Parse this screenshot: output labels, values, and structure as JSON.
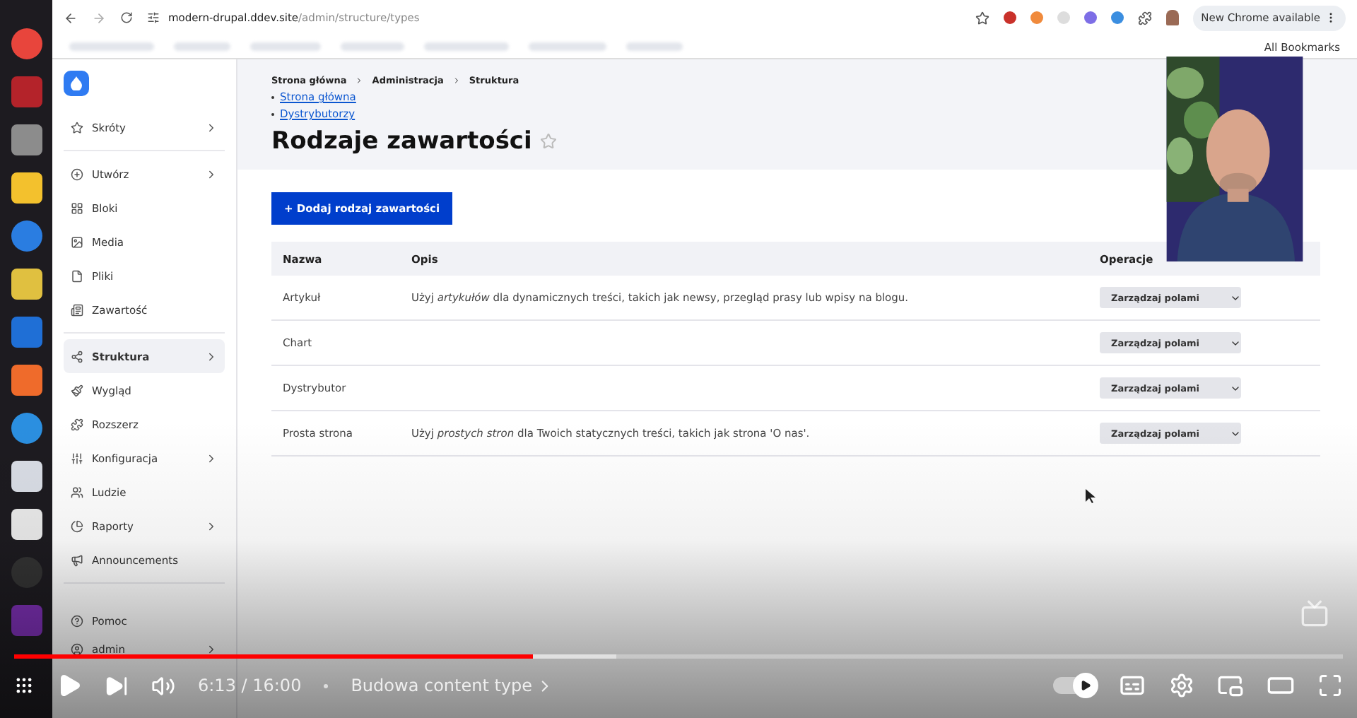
{
  "browser": {
    "url_host": "modern-drupal.ddev.site",
    "url_path": "/admin/structure/types",
    "update_button": "New Chrome available",
    "bookmarks_label": "All Bookmarks"
  },
  "sidebar": {
    "sections": [
      {
        "items": [
          {
            "label": "Skróty",
            "has_children": true,
            "selected": false
          }
        ]
      },
      {
        "items": [
          {
            "label": "Utwórz",
            "has_children": true,
            "selected": false
          },
          {
            "label": "Bloki",
            "has_children": false,
            "selected": false
          },
          {
            "label": "Media",
            "has_children": false,
            "selected": false
          },
          {
            "label": "Pliki",
            "has_children": false,
            "selected": false
          },
          {
            "label": "Zawartość",
            "has_children": false,
            "selected": false
          }
        ]
      },
      {
        "items": [
          {
            "label": "Struktura",
            "has_children": true,
            "selected": true
          },
          {
            "label": "Wygląd",
            "has_children": false,
            "selected": false
          },
          {
            "label": "Rozszerz",
            "has_children": false,
            "selected": false
          },
          {
            "label": "Konfiguracja",
            "has_children": true,
            "selected": false
          },
          {
            "label": "Ludzie",
            "has_children": false,
            "selected": false
          },
          {
            "label": "Raporty",
            "has_children": true,
            "selected": false
          },
          {
            "label": "Announcements",
            "has_children": false,
            "selected": false
          }
        ]
      },
      {
        "items": [
          {
            "label": "Pomoc",
            "has_children": false,
            "selected": false
          },
          {
            "label": "admin",
            "has_children": true,
            "selected": false
          }
        ]
      }
    ]
  },
  "breadcrumb": [
    "Strona główna",
    "Administracja",
    "Struktura"
  ],
  "links": [
    "Strona główna",
    "Dystrybutorzy"
  ],
  "title": "Rodzaje zawartości",
  "add_button": "+ Dodaj rodzaj zawartości",
  "table": {
    "columns": [
      "Nazwa",
      "Opis",
      "Operacje"
    ],
    "rows": [
      {
        "name": "Artykuł",
        "description": "Użyj *artykułów* dla dynamicznych treści, takich jak newsy, przegląd prasy lub wpisy na blogu.",
        "operation": "Zarządzaj polami"
      },
      {
        "name": "Chart",
        "operation": "Zarządzaj polami"
      },
      {
        "name": "Dystrybutor",
        "operation": "Zarządzaj polami"
      },
      {
        "name": "Prosta strona",
        "description": "Użyj *prostych stron* dla Twoich statycznych treści, takich jak strona 'O nas'.",
        "operation": "Zarządzaj polami"
      }
    ]
  },
  "player": {
    "level": 0.39,
    "time": "6:13 / 16:00",
    "chapter": "Budowa content type",
    "autoplay": true
  }
}
